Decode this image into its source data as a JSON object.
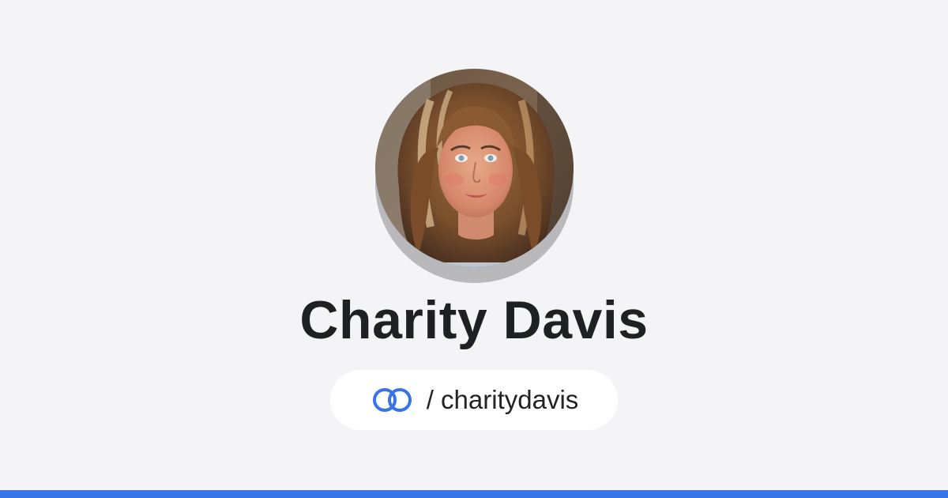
{
  "profile": {
    "name": "Charity Davis",
    "separator": "/",
    "handle": "charitydavis",
    "avatar_alt": "profile photo"
  },
  "icons": {
    "brand": "interlocked-rings-logo-icon"
  },
  "colors": {
    "background": "#f4f4f6",
    "accent": "#3873e8",
    "name_text": "#1f2022",
    "pill_background": "#ffffff",
    "avatar_shadow": "#b9b9bc"
  }
}
